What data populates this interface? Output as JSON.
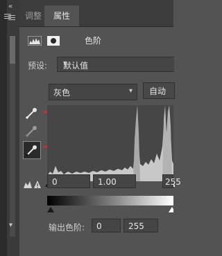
{
  "tabs": {
    "adjust_label": "调整",
    "properties_label": "属性"
  },
  "panel": {
    "title": "色阶"
  },
  "preset": {
    "label": "预设:",
    "value": "默认值"
  },
  "channel": {
    "value": "灰色"
  },
  "auto_button": {
    "label": "自动"
  },
  "input_levels": {
    "black": "0",
    "gamma": "1.00",
    "white": "255"
  },
  "output_levels": {
    "label": "输出色阶:",
    "black": "0",
    "white": "255"
  },
  "colors": {
    "annotation_arrow": "#e0292a",
    "panel_bg": "#535353",
    "histogram_bg": "#464646"
  }
}
